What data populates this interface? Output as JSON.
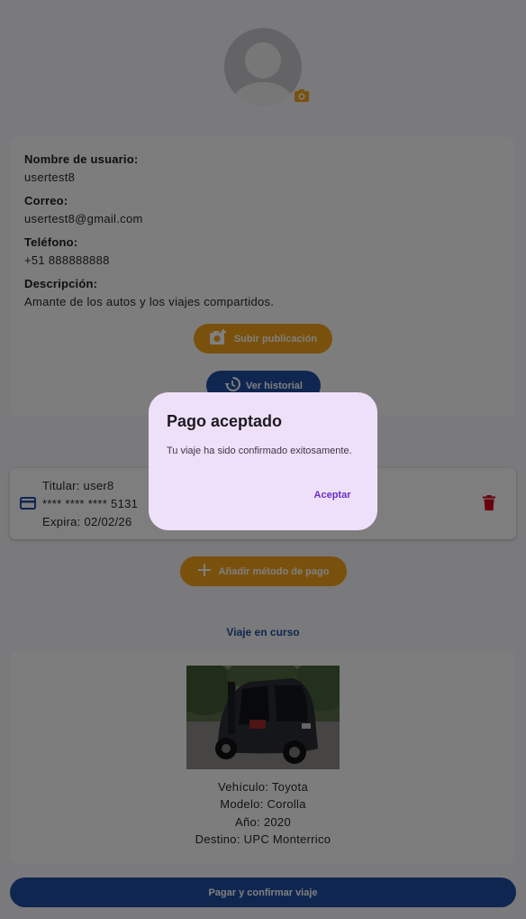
{
  "profile": {
    "username_label": "Nombre de usuario:",
    "username": "usertest8",
    "email_label": "Correo:",
    "email": "usertest8@gmail.com",
    "phone_label": "Teléfono:",
    "phone": "+51 888888888",
    "description_label": "Descripción:",
    "description": "Amante de los autos y los viajes compartidos.",
    "upload_button": "Subir publicación",
    "history_button": "Ver historial"
  },
  "payment_method": {
    "holder": "Titular: user8",
    "number": "**** **** **** 5131",
    "expiry": "Expira: 02/02/26",
    "add_button": "Añadir método de pago"
  },
  "trip": {
    "section_title": "Viaje en curso",
    "vehicle": "Vehículo: Toyota",
    "model": "Modelo: Corolla",
    "year": "Año: 2020",
    "destination": "Destino: UPC Monterrico",
    "pay_button": "Pagar y confirmar viaje"
  },
  "dialog": {
    "title": "Pago aceptado",
    "message": "Tu viaje ha sido confirmado exitosamente.",
    "accept_button": "Aceptar"
  },
  "icons": {
    "camera": "camera-icon",
    "add_photo": "add-photo-icon",
    "history": "history-icon",
    "credit_card": "credit-card-icon",
    "delete": "delete-icon",
    "add": "plus-icon"
  },
  "colors": {
    "primary": "#1f4ea0",
    "accent": "#f3a21a",
    "danger": "#d0021b",
    "dialog_bg": "#efe0fa",
    "dialog_action": "#6b2ec8"
  }
}
